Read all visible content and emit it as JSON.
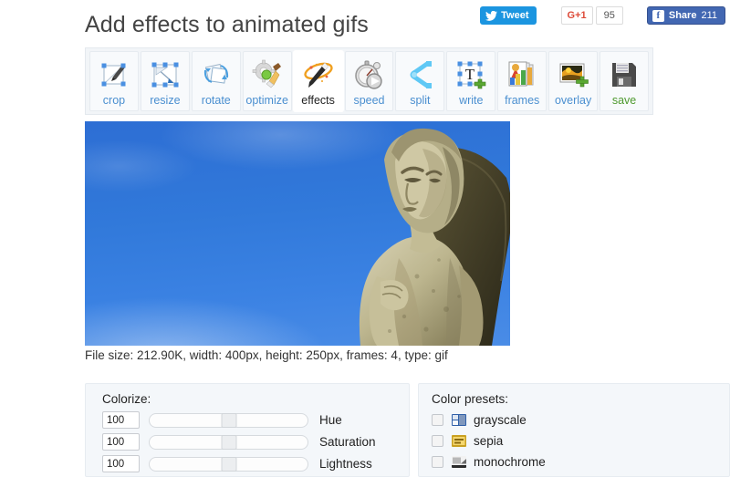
{
  "header": {
    "title": "Add effects to animated gifs",
    "social": {
      "tweet_label": "Tweet",
      "gplus_label": "G+1",
      "gplus_count": "95",
      "facebook_label": "Share",
      "facebook_count": "211",
      "tweet_color": "#1b95e0",
      "gplus_color": "#dd4b39",
      "facebook_color": "#4267b2"
    }
  },
  "toolbar": {
    "active": "effects",
    "items": [
      {
        "id": "crop",
        "label": "crop",
        "icon": "crop-icon"
      },
      {
        "id": "resize",
        "label": "resize",
        "icon": "resize-icon"
      },
      {
        "id": "rotate",
        "label": "rotate",
        "icon": "rotate-icon"
      },
      {
        "id": "optimize",
        "label": "optimize",
        "icon": "optimize-icon"
      },
      {
        "id": "effects",
        "label": "effects",
        "icon": "effects-icon"
      },
      {
        "id": "speed",
        "label": "speed",
        "icon": "speed-icon"
      },
      {
        "id": "split",
        "label": "split",
        "icon": "split-icon"
      },
      {
        "id": "write",
        "label": "write",
        "icon": "write-icon"
      },
      {
        "id": "frames",
        "label": "frames",
        "icon": "frames-icon"
      },
      {
        "id": "overlay",
        "label": "overlay",
        "icon": "overlay-icon"
      },
      {
        "id": "save",
        "label": "save",
        "icon": "save-icon"
      }
    ]
  },
  "preview": {
    "alt": "angel statue against blue sky",
    "loading": true,
    "sky_color": "#3179da"
  },
  "file_info": "File size: 212.90K, width: 400px, height: 250px, frames: 4, type: gif",
  "colorize": {
    "title": "Colorize:",
    "sliders": [
      {
        "id": "hue",
        "label": "Hue",
        "value": "100",
        "position": 50
      },
      {
        "id": "saturation",
        "label": "Saturation",
        "value": "100",
        "position": 50
      },
      {
        "id": "lightness",
        "label": "Lightness",
        "value": "100",
        "position": 50
      }
    ]
  },
  "presets": {
    "title": "Color presets:",
    "items": [
      {
        "id": "grayscale",
        "label": "grayscale",
        "checked": false,
        "icon": "grayscale-swatch-icon"
      },
      {
        "id": "sepia",
        "label": "sepia",
        "checked": false,
        "icon": "sepia-swatch-icon"
      },
      {
        "id": "monochrome",
        "label": "monochrome",
        "checked": false,
        "icon": "monochrome-swatch-icon"
      }
    ]
  }
}
